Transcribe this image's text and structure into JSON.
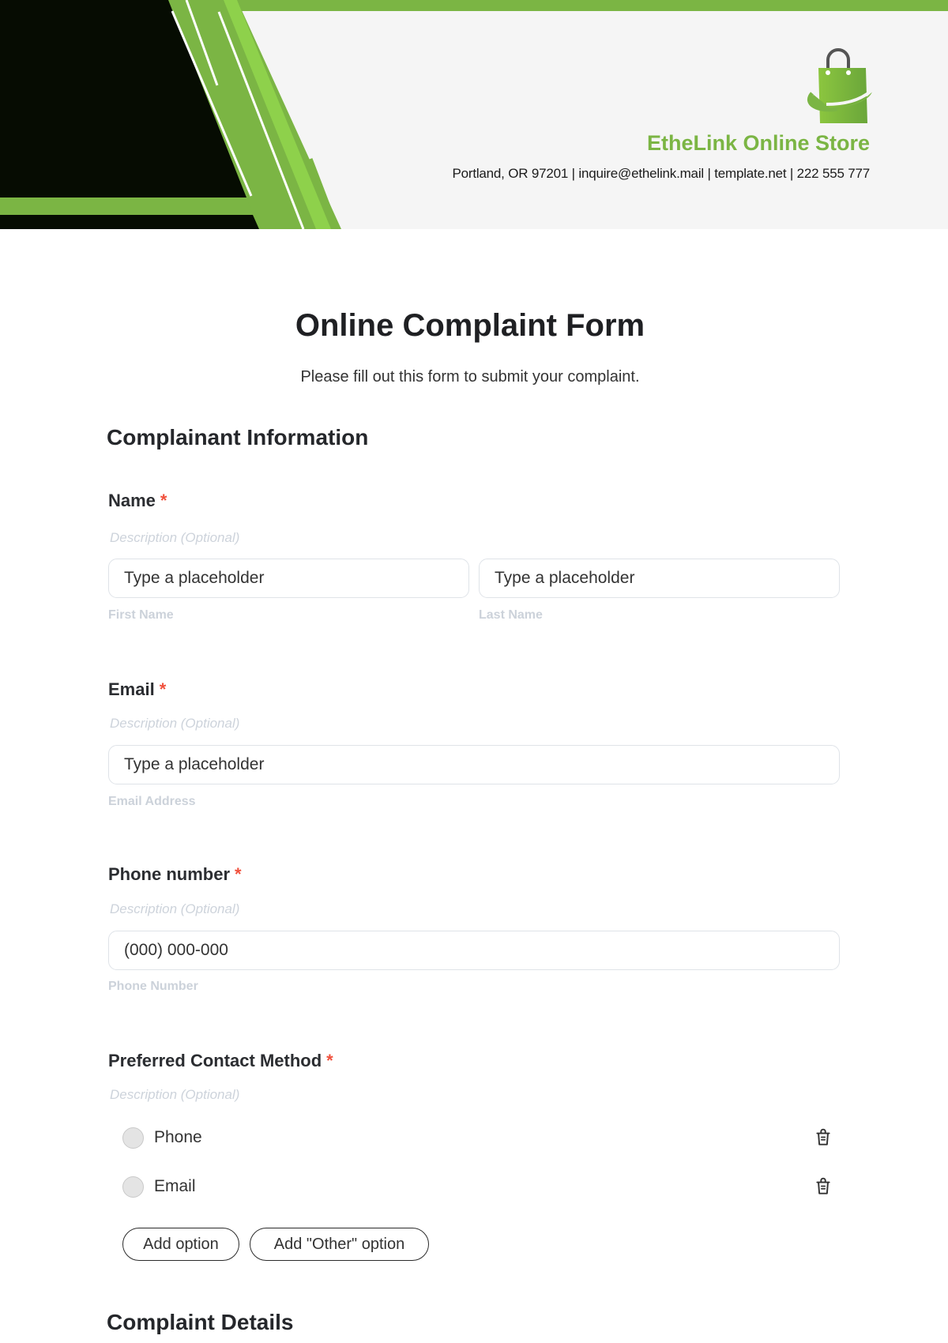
{
  "header": {
    "store_name": "EtheLink Online Store",
    "contact_line": "Portland, OR 97201 | inquire@ethelink.mail | template.net | 222 555 777",
    "brand_color": "#7bb544",
    "logo_icon": "shopping-bag-icon"
  },
  "form": {
    "title": "Online Complaint Form",
    "subtitle": "Please fill out this form to submit your complaint.",
    "sections": [
      {
        "title": "Complainant Information",
        "fields": [
          {
            "label": "Name",
            "required_mark": "*",
            "description": "Description (Optional)",
            "inputs": [
              {
                "placeholder": "Type a placeholder",
                "helper": "First Name"
              },
              {
                "placeholder": "Type a placeholder",
                "helper": "Last Name"
              }
            ]
          },
          {
            "label": "Email",
            "required_mark": "*",
            "description": "Description (Optional)",
            "inputs": [
              {
                "placeholder": "Type a placeholder",
                "helper": "Email Address"
              }
            ]
          },
          {
            "label": "Phone number",
            "required_mark": "*",
            "description": "Description (Optional)",
            "inputs": [
              {
                "placeholder": "(000) 000-000",
                "helper": "Phone Number"
              }
            ]
          },
          {
            "label": "Preferred Contact Method",
            "required_mark": "*",
            "description": "Description (Optional)",
            "options": [
              {
                "label": "Phone",
                "selected": false,
                "delete_icon": "trash-icon"
              },
              {
                "label": "Email",
                "selected": false,
                "delete_icon": "trash-icon"
              }
            ],
            "add_option_label": "Add option",
            "add_other_option_label": "Add \"Other\" option"
          }
        ]
      },
      {
        "title": "Complaint Details"
      }
    ]
  }
}
